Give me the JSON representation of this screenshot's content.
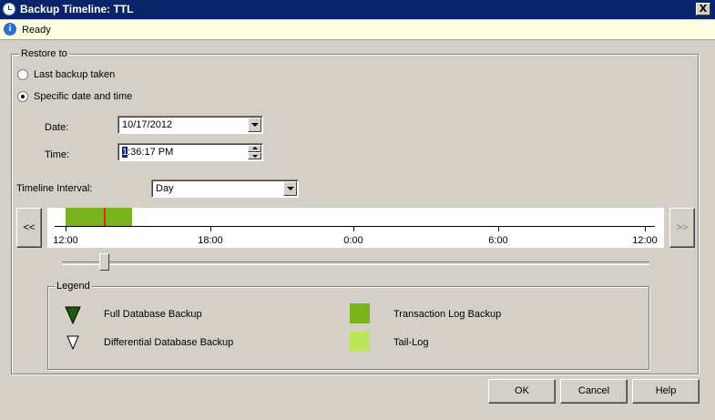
{
  "window": {
    "title": "Backup Timeline: TTL",
    "close_glyph": "X"
  },
  "status": {
    "text": "Ready",
    "icon_glyph": "i"
  },
  "restore": {
    "group_label": "Restore to",
    "option_last": "Last backup taken",
    "option_specific": "Specific date and time",
    "selected": "specific",
    "date_label": "Date:",
    "date_value": "10/17/2012",
    "time_label": "Time:",
    "time_caret_char": "1",
    "time_value_rest": ":36:17 PM",
    "interval_label": "Timeline Interval:",
    "interval_value": "Day"
  },
  "timeline": {
    "prev_label": "<<",
    "next_label": ">>",
    "ticks": [
      "12:00",
      "18:00",
      "0:00",
      "6:00",
      "12:00"
    ],
    "log_backup_color": "#7ab31e",
    "marker_color": "#e0281c"
  },
  "legend": {
    "label": "Legend",
    "items": [
      {
        "label": "Full Database Backup",
        "icon": "full-backup-triangle-icon",
        "color": "#1e5a0a"
      },
      {
        "label": "Differential Database Backup",
        "icon": "differential-backup-triangle-icon",
        "color": "#ffffff"
      },
      {
        "label": "Transaction Log Backup",
        "icon": "transaction-log-swatch-icon",
        "color": "#7ab31e"
      },
      {
        "label": "Tail-Log",
        "icon": "tail-log-swatch-icon",
        "color": "#bde65a"
      }
    ]
  },
  "buttons": {
    "ok": "OK",
    "cancel": "Cancel",
    "help": "Help"
  }
}
